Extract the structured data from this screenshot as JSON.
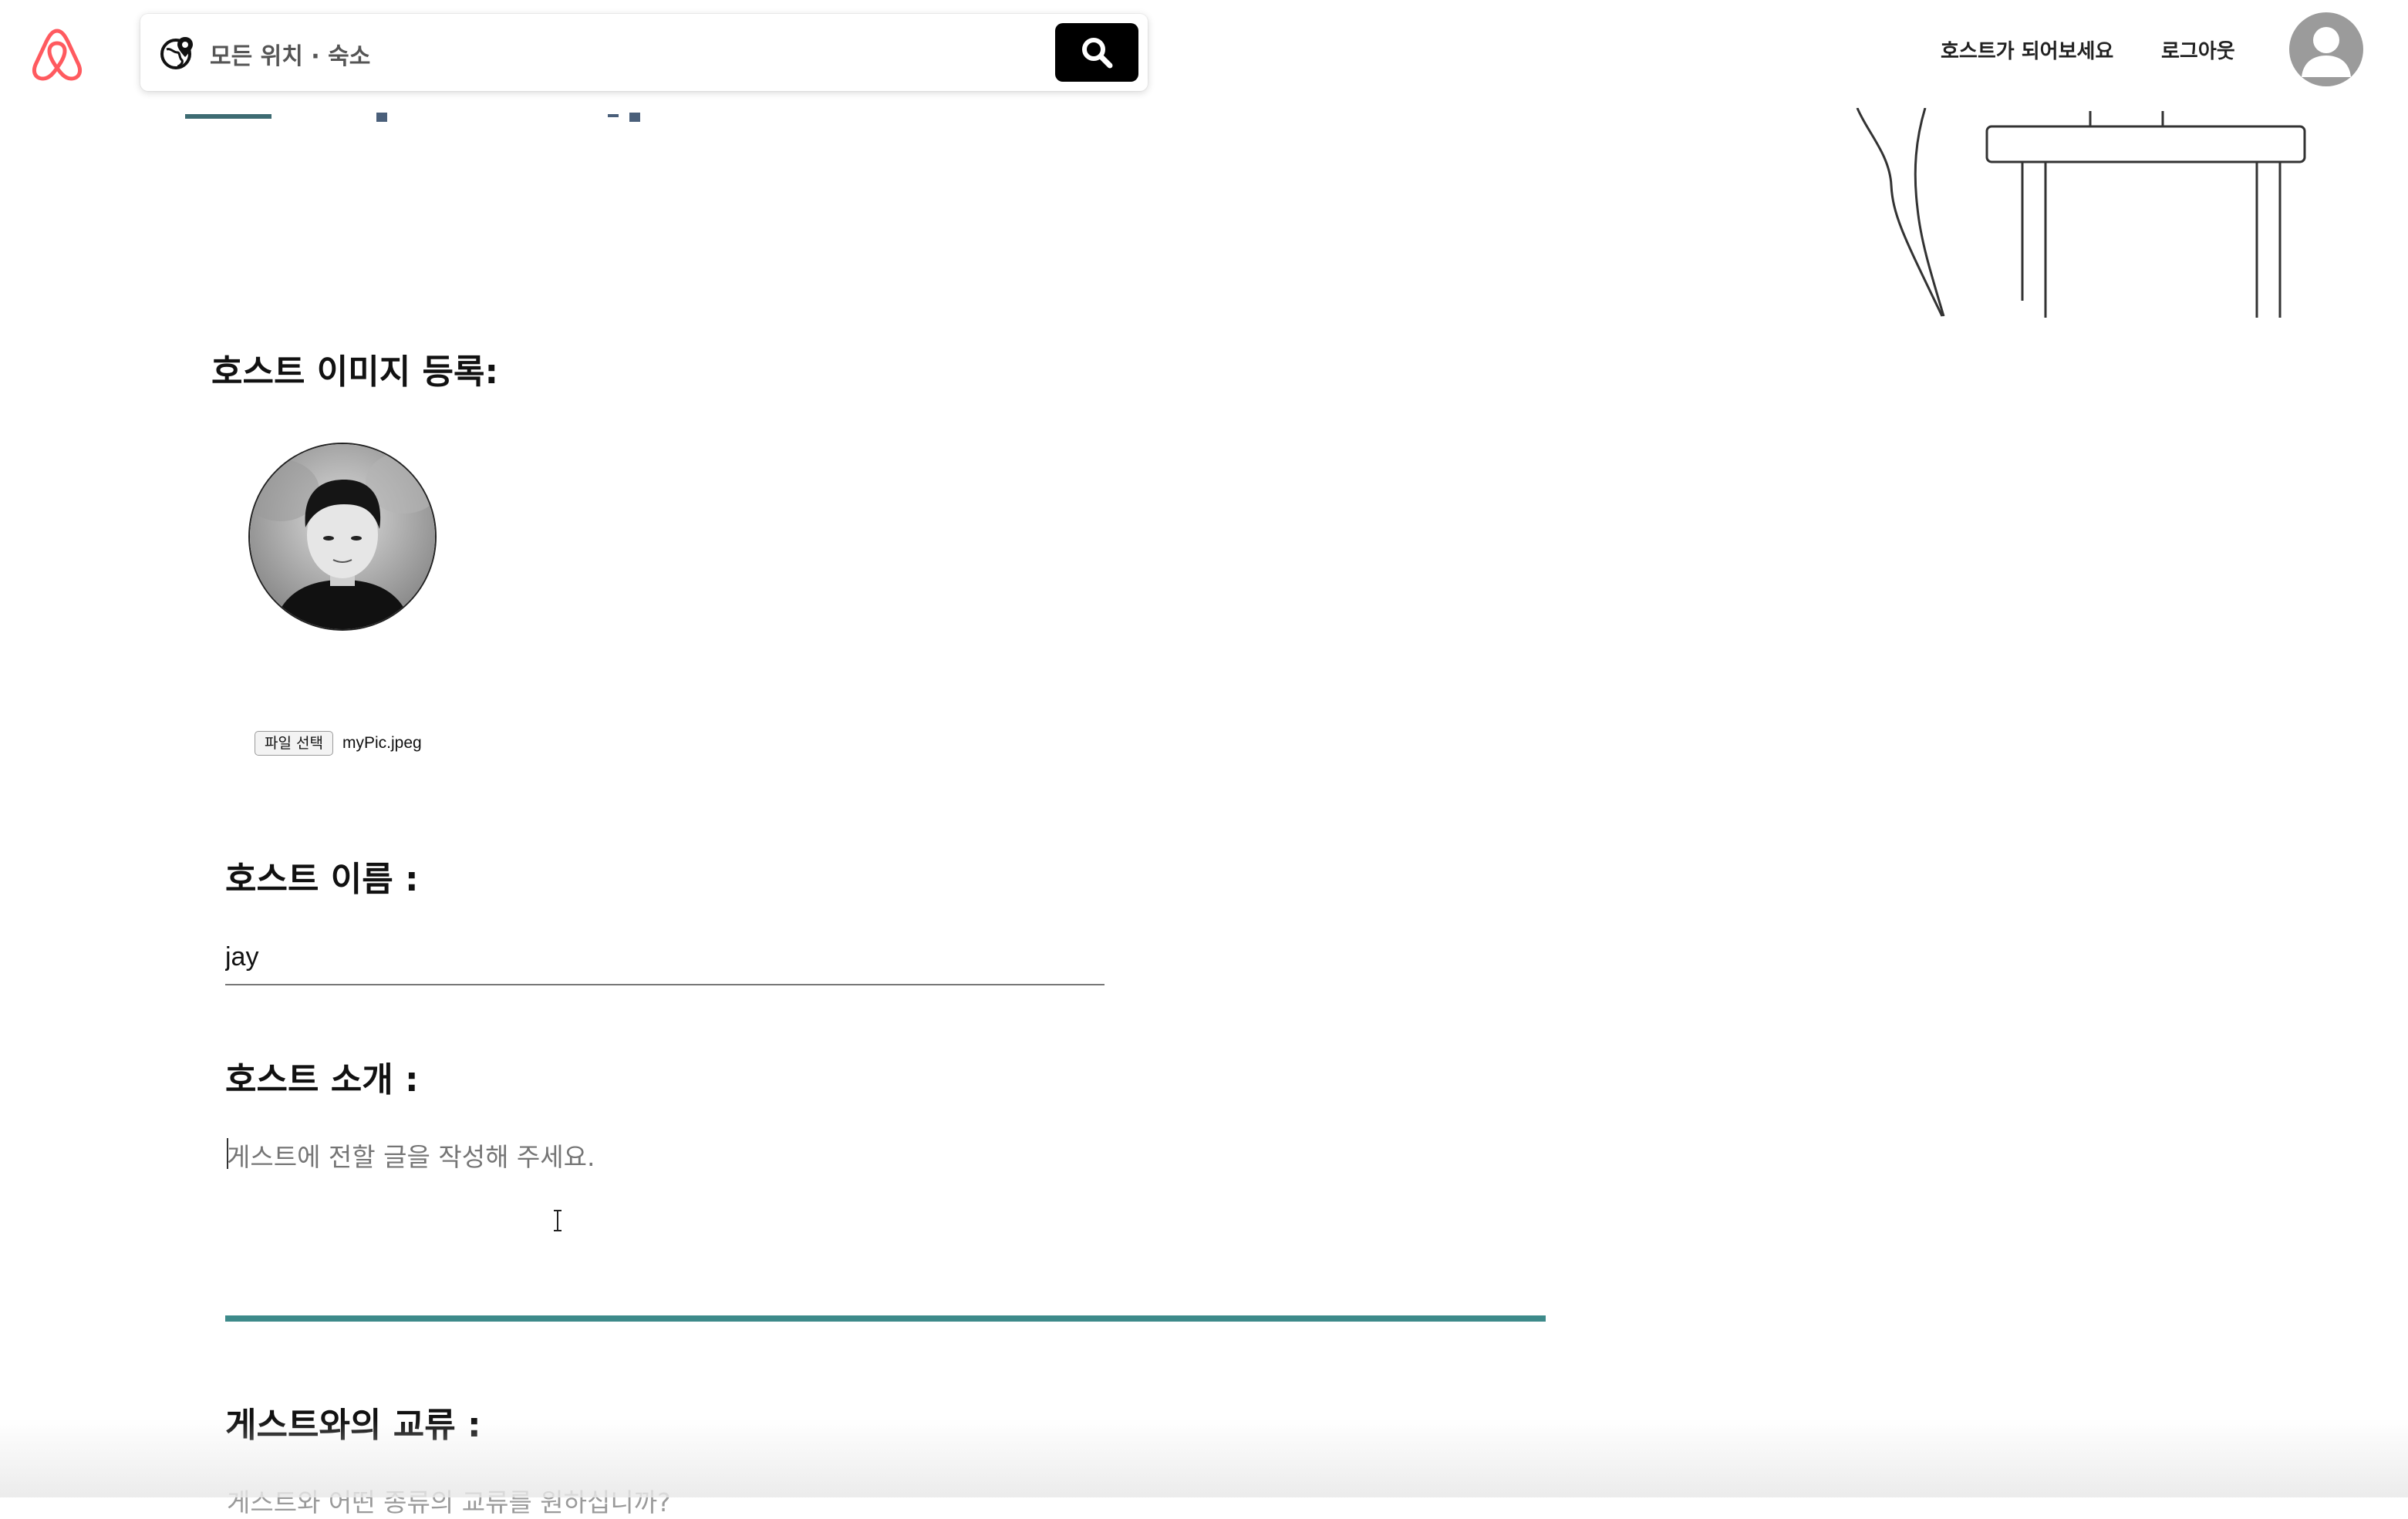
{
  "header": {
    "search_placeholder": "모든 위치 · 숙소",
    "become_host": "호스트가 되어보세요",
    "logout": "로그아웃"
  },
  "form": {
    "host_image_label": "호스트 이미지 등록:",
    "file_button": "파일 선택",
    "file_name": "myPic.jpeg",
    "host_name_label": "호스트 이름 :",
    "host_name_value": "jay",
    "host_intro_label": "호스트 소개 :",
    "host_intro_placeholder": "게스트에 전할 글을 작성해 주세요.",
    "guest_interaction_label": "게스트와의 교류 :",
    "guest_interaction_placeholder": "게스트와 어떤 종류의 교류를 원하십니까?"
  },
  "colors": {
    "brand": "#ff5a5f",
    "accent": "#3d8a8a",
    "search_button": "#000000"
  },
  "icons": [
    "airbnb-logo-icon",
    "globe-pin-icon",
    "search-icon",
    "user-avatar-icon"
  ]
}
